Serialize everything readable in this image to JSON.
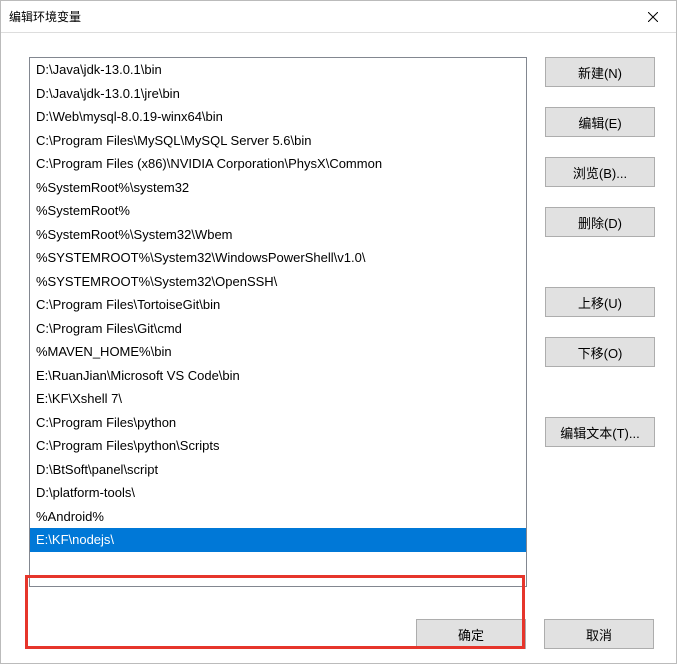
{
  "dialog": {
    "title": "编辑环境变量"
  },
  "list": {
    "items": [
      {
        "value": "D:\\Java\\jdk-13.0.1\\bin",
        "selected": false
      },
      {
        "value": "D:\\Java\\jdk-13.0.1\\jre\\bin",
        "selected": false
      },
      {
        "value": "D:\\Web\\mysql-8.0.19-winx64\\bin",
        "selected": false
      },
      {
        "value": "C:\\Program Files\\MySQL\\MySQL Server 5.6\\bin",
        "selected": false
      },
      {
        "value": "C:\\Program Files (x86)\\NVIDIA Corporation\\PhysX\\Common",
        "selected": false
      },
      {
        "value": "%SystemRoot%\\system32",
        "selected": false
      },
      {
        "value": "%SystemRoot%",
        "selected": false
      },
      {
        "value": "%SystemRoot%\\System32\\Wbem",
        "selected": false
      },
      {
        "value": "%SYSTEMROOT%\\System32\\WindowsPowerShell\\v1.0\\",
        "selected": false
      },
      {
        "value": "%SYSTEMROOT%\\System32\\OpenSSH\\",
        "selected": false
      },
      {
        "value": "C:\\Program Files\\TortoiseGit\\bin",
        "selected": false
      },
      {
        "value": "C:\\Program Files\\Git\\cmd",
        "selected": false
      },
      {
        "value": "%MAVEN_HOME%\\bin",
        "selected": false
      },
      {
        "value": "E:\\RuanJian\\Microsoft VS Code\\bin",
        "selected": false
      },
      {
        "value": "E:\\KF\\Xshell 7\\",
        "selected": false
      },
      {
        "value": "C:\\Program Files\\python",
        "selected": false
      },
      {
        "value": "C:\\Program Files\\python\\Scripts",
        "selected": false
      },
      {
        "value": "D:\\BtSoft\\panel\\script",
        "selected": false
      },
      {
        "value": "D:\\platform-tools\\",
        "selected": false
      },
      {
        "value": "%Android%",
        "selected": false
      },
      {
        "value": "E:\\KF\\nodejs\\",
        "selected": true
      }
    ]
  },
  "buttons": {
    "new": "新建(N)",
    "edit": "编辑(E)",
    "browse": "浏览(B)...",
    "delete": "删除(D)",
    "moveUp": "上移(U)",
    "moveDown": "下移(O)",
    "editText": "编辑文本(T)...",
    "ok": "确定",
    "cancel": "取消"
  }
}
